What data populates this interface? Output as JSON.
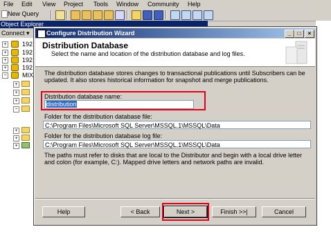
{
  "menu": [
    "File",
    "Edit",
    "View",
    "Project",
    "Tools",
    "Window",
    "Community",
    "Help"
  ],
  "toolbar": {
    "new_query": "New Query"
  },
  "object_explorer": {
    "title": "Object Explorer",
    "connect": "Connect ▾",
    "servers": [
      "192",
      "192",
      "192",
      "192",
      "MIX"
    ]
  },
  "dialog": {
    "title": "Configure Distribution Wizard",
    "header_title": "Distribution Database",
    "header_subtitle": "Select the name and location of the distribution database and log files.",
    "description": "The distribution database stores changes to transactional publications until Subscribers can be updated. It also stores historical information for snapshot and merge publications.",
    "db_name_label": "Distribution database name:",
    "db_name_value": "distribution",
    "data_folder_label": "Folder for the distribution database file:",
    "data_folder_value": "C:\\Program Files\\Microsoft SQL Server\\MSSQL.1\\MSSQL\\Data",
    "log_folder_label": "Folder for the distribution database log file:",
    "log_folder_value": "C:\\Program Files\\Microsoft SQL Server\\MSSQL.1\\MSSQL\\Data",
    "note": "The paths must refer to disks that are local to the Distributor and begin with a local drive letter and colon (for example, C:). Mapped drive letters and network paths are invalid.",
    "buttons": {
      "help": "Help",
      "back": "< Back",
      "next": "Next >",
      "finish": "Finish >>|",
      "cancel": "Cancel"
    }
  },
  "colors": {
    "title_bar": "#0a246a",
    "highlight": "#e0001a",
    "selection": "#316ac5"
  }
}
